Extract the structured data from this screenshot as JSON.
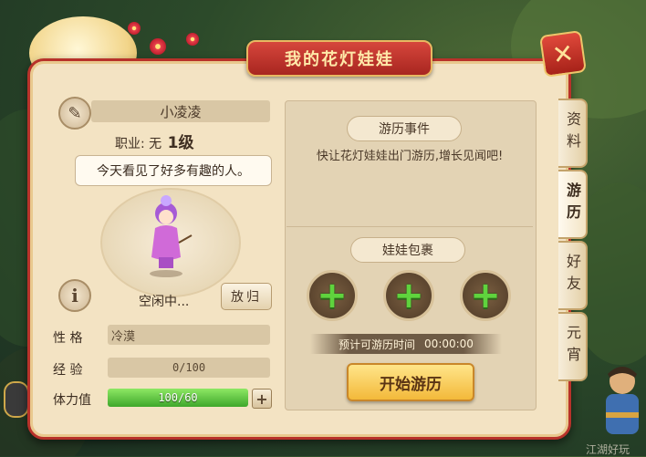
{
  "window": {
    "title": "我的花灯娃娃",
    "close_glyph": "✕"
  },
  "doll": {
    "name": "小凌凌",
    "job_label": "职业:",
    "job_value": "无",
    "level": "1级",
    "speech": "今天看见了好多有趣的人。",
    "status": "空闲中...",
    "return_button": "放归"
  },
  "stats": {
    "personality_label": "性 格",
    "personality_value": "冷漠",
    "exp_label": "经 验",
    "exp_value": "0/100",
    "stamina_label": "体力值",
    "stamina_value": "100/60",
    "stamina_fill_fraction": 1.0
  },
  "travel": {
    "event_title": "游历事件",
    "event_desc": "快让花灯娃娃出门游历,增长见闻吧!",
    "bag_title": "娃娃包裹",
    "slots": [
      "+",
      "+",
      "+"
    ],
    "time_label": "预计可游历时间",
    "time_value": "00:00:00",
    "start_button": "开始游历"
  },
  "tabs": [
    {
      "label": "资料",
      "active": false
    },
    {
      "label": "游历",
      "active": true
    },
    {
      "label": "好友",
      "active": false
    },
    {
      "label": "元宵",
      "active": false
    }
  ],
  "icons": {
    "edit": "edit-pencil-icon",
    "info": "info-icon",
    "add": "plus-icon",
    "mic": "microphone-icon"
  },
  "watermark": "江湖好玩",
  "colors": {
    "frame_red": "#b8322a",
    "panel": "#f3e3c3",
    "accent_gold": "#f3b93a",
    "stamina_green": "#3ea72b"
  }
}
